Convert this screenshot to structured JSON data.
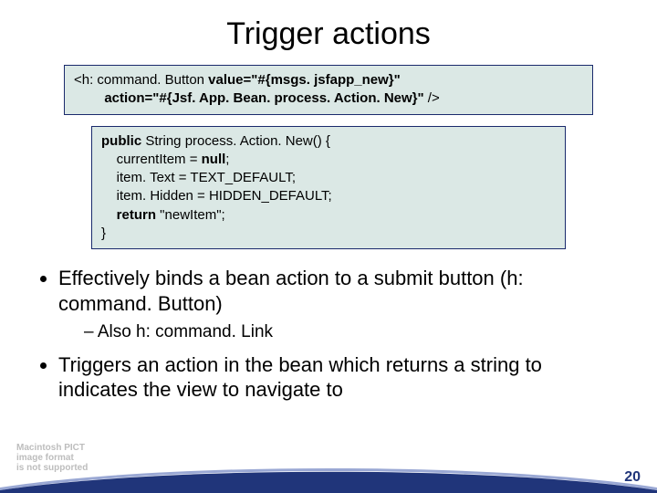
{
  "title": "Trigger actions",
  "code_xml": {
    "l1a": "<h: command. Button ",
    "l1b": "value=\"#{msgs. jsfapp_new}\"",
    "l2a": "        action=\"#{Jsf. App. Bean. process. Action. New}\" ",
    "l2b": "/>"
  },
  "code_java": {
    "l1a": "public",
    "l1b": " String process. Action. New() {",
    "l2a": "    currentItem = ",
    "l2b": "null",
    "l2c": ";",
    "l3": "    item. Text = TEXT_DEFAULT;",
    "l4": "    item. Hidden = HIDDEN_DEFAULT;",
    "l5a": "    ",
    "l5b": "return",
    "l5c": " \"newItem\";",
    "l6": "}"
  },
  "bullets": {
    "b1": "Effectively binds a bean action to a submit button (h: command. Button)",
    "b1a": "Also h: command. Link",
    "b2": "Triggers an action in the bean which returns a string to indicates the view to navigate to"
  },
  "placeholder": {
    "l1": "Macintosh PICT",
    "l2": "image format",
    "l3": "is not supported"
  },
  "page": "20"
}
